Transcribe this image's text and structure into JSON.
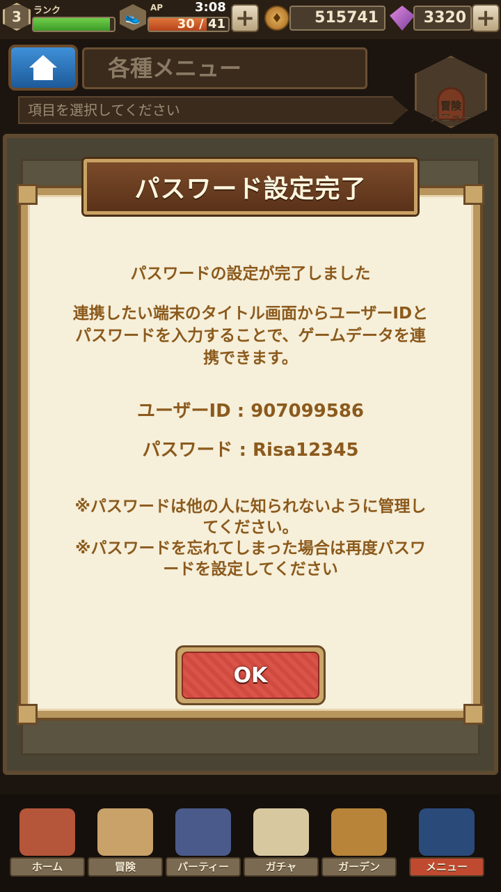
{
  "status": {
    "rank_level": "3",
    "rank_label": "ランク",
    "rank_progress": 0.95,
    "ap_label": "AP",
    "time": "3:08",
    "ap_value": "30 / 41",
    "ap_progress": 0.73,
    "coins": "515741",
    "gems": "3320",
    "plus_glyph": "+"
  },
  "header": {
    "title": "各種メニュー",
    "subtitle": "項目を選択してください",
    "adventure_menu_label_1": "冒険",
    "adventure_menu_label_2": "メニュー"
  },
  "dialog": {
    "title": "パスワード設定完了",
    "message_1": "パスワードの設定が完了しました",
    "message_2_lines": [
      "連携したい端末のタイトル画面からユーザーIDと",
      "パスワードを入力することで、ゲームデータを連",
      "携できます。"
    ],
    "user_id_line": "ユーザーID : 907099586",
    "password_line": "パスワード : Risa12345",
    "note_lines": [
      "※パスワードは他の人に知られないように管理し",
      "てください。",
      "※パスワードを忘れてしまった場合は再度パスワ",
      "ードを設定してください"
    ],
    "ok_label": "OK"
  },
  "nav": {
    "items": [
      {
        "label": "ホーム",
        "icon": "house-icon",
        "color": "#b5553a"
      },
      {
        "label": "冒険",
        "icon": "map-icon",
        "color": "#c9a26a"
      },
      {
        "label": "パーティー",
        "icon": "chess-icon",
        "color": "#4a5a8a"
      },
      {
        "label": "ガチャ",
        "icon": "dice-icon",
        "color": "#d8c8a0"
      },
      {
        "label": "ガーデン",
        "icon": "basket-icon",
        "color": "#b8843a"
      },
      {
        "label": "メニュー",
        "icon": "book-icon",
        "color": "#2a4a7a"
      }
    ],
    "active_index": 5
  }
}
